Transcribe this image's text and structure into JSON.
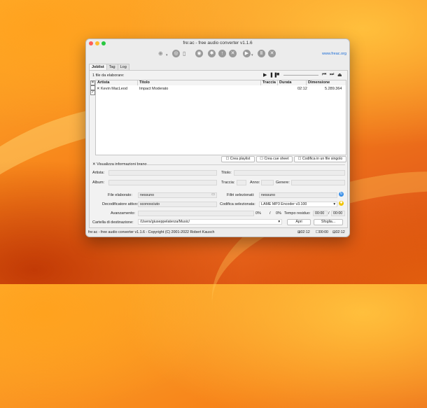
{
  "window": {
    "title": "fre:ac - free audio converter v1.1.6",
    "link": "www.freac.org"
  },
  "traffic": [
    "#ff5f57",
    "#febc2e",
    "#28c840"
  ],
  "toolbar_icons": [
    "add-files-icon",
    "add-folder-icon",
    "remove-icon",
    "clear-icon",
    "cddb-icon",
    "cddb-submit-icon",
    "cddb-query-icon",
    "configure-icon",
    "play-icon",
    "pause-icon",
    "stop-icon"
  ],
  "tabs": [
    "Joblist",
    "Tag",
    "Log"
  ],
  "joblist": {
    "count_label": "1 file da elaborare:",
    "columns": [
      "Artista",
      "Titolo",
      "Traccia",
      "Durata",
      "Dimensione"
    ],
    "rows": [
      {
        "artist": "Kevin MacLeod",
        "title": "Impact Moderato",
        "track": "",
        "duration": "02:12",
        "size": "5.289.364"
      }
    ]
  },
  "options": {
    "create_playlist": "Crea playlist",
    "create_cue": "Crea cue sheet",
    "single_file": "Codifica in un file singolo"
  },
  "info": {
    "show_label": "Visualizza informazioni brano",
    "artist_label": "Artista:",
    "title_label": "Titolo:",
    "album_label": "Album:",
    "track_label": "Traccia:",
    "year_label": "Anno:",
    "genre_label": "Genere:"
  },
  "status_panel": {
    "file_label": "File elaborato:",
    "file_value": "nessuno",
    "filters_label": "Filtri selezionati:",
    "filters_value": "nessuno",
    "decoder_label": "Decodificatore attivo:",
    "decoder_value": "sconosciuto",
    "encoder_label": "Codifica selezionata:",
    "encoder_value": "LAME MP3 Encoder v3.100",
    "progress_label": "Avanzamento:",
    "progress_percent": "0%",
    "progress_sep": "/",
    "progress_percent2": "0%",
    "time_label": "Tempo residuo:",
    "time_value": "00:00",
    "time_sep": "/",
    "time_value2": "00:00",
    "dest_label": "Cartella di destinazione:",
    "dest_value": "/Users/giuseppelaterza/Music/",
    "open_button": "Apri",
    "browse_button": "Sfoglia..."
  },
  "statusbar": {
    "text": "fre:ac - free audio converter v1.1.6 - Copyright (C) 2001-2022 Robert Kausch",
    "t1": "02:12",
    "t2": "00:00",
    "t3": "02:12"
  }
}
